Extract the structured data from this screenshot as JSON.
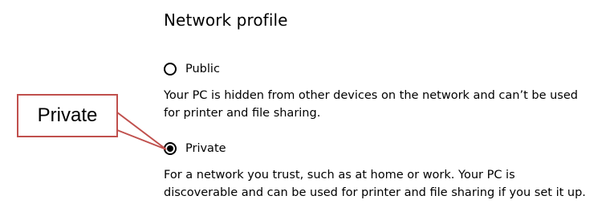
{
  "network_profile": {
    "heading": "Network profile",
    "options": [
      {
        "label": "Public",
        "selected": false,
        "description_lines": [
          "Your PC is hidden from other devices on the network and can’t be used",
          "for printer and file sharing."
        ]
      },
      {
        "label": "Private",
        "selected": true,
        "description_lines": [
          "For a network you trust, such as at home or work. Your PC is",
          "discoverable and can be used for printer and file sharing if you set it up."
        ]
      }
    ]
  },
  "annotation": {
    "callout_text": "Private",
    "border_color": "#c0504d"
  }
}
